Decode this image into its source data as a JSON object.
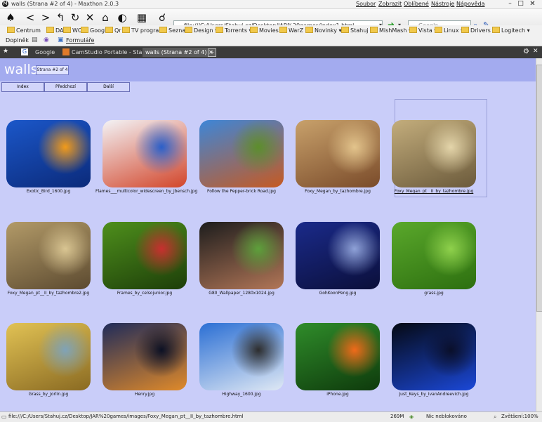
{
  "window": {
    "title": "walls (Strana #2 of 4) - Maxthon 2.0.3",
    "menu": [
      "Soubor",
      "Zobrazit",
      "Oblíbené",
      "Nástroje",
      "Nápověda"
    ]
  },
  "toolbar": {
    "address": "file:///C:/Users/Stahuj.cz/Desktop/JAR%20games/index1.html",
    "search_placeholder": "Google"
  },
  "bookmarks": [
    {
      "label": "Centrum"
    },
    {
      "label": "DA"
    },
    {
      "label": "WC"
    },
    {
      "label": "Google"
    },
    {
      "label": "Qr"
    },
    {
      "label": "TV program"
    },
    {
      "label": "Seznam"
    },
    {
      "label": "Design"
    },
    {
      "label": "Torrents"
    },
    {
      "label": "Movies"
    },
    {
      "label": "WarZ"
    },
    {
      "label": "Novinky"
    },
    {
      "label": "Stahuj"
    },
    {
      "label": "MishMash"
    },
    {
      "label": "Vista"
    },
    {
      "label": "Linux"
    },
    {
      "label": "Drivers"
    },
    {
      "label": "Logitech"
    }
  ],
  "row3": {
    "plugins": "Doplněk",
    "forms": "Formuláře"
  },
  "tabs": [
    {
      "label": "Google"
    },
    {
      "label": "CamStudio Portable - Stahuj.cz"
    },
    {
      "label": "walls (Strana #2 of 4)"
    }
  ],
  "page": {
    "title": "walls",
    "badge": "Strana #2 of 4",
    "nav": [
      "Index",
      "Předchozí",
      "Další"
    ]
  },
  "gallery": [
    {
      "file": "Exotic_Bird_1600.jpg",
      "c1": "#1b57c9",
      "c2": "#0b2a7a",
      "c3": "#f29b1a"
    },
    {
      "file": "Flames___multicolor_widescreen_by_jbensch.jpg",
      "c1": "#f3f3f6",
      "c2": "#d2452a",
      "c3": "#2a5fc9"
    },
    {
      "file": "Follow the Pepper-brick Road.jpg",
      "c1": "#3d86d8",
      "c2": "#c65a22",
      "c3": "#5c8e2c"
    },
    {
      "file": "Foxy_Megan_by_tazhombre.jpg",
      "c1": "#c8a16b",
      "c2": "#7a4b2a",
      "c3": "#e3c48c"
    },
    {
      "file": "Foxy_Megan_pt__II_by_tazhombre.jpg",
      "c1": "#c3ad7c",
      "c2": "#6b5a3b",
      "c3": "#e4d5aa",
      "selected": true
    },
    {
      "file": "Foxy_Megan_pt__II_by_tazhombre2.jpg",
      "c1": "#b29a68",
      "c2": "#5c4a30",
      "c3": "#d9c592"
    },
    {
      "file": "Frames_by_celsojunior.jpg",
      "c1": "#4e8f1c",
      "c2": "#1d3e09",
      "c3": "#c82f2f"
    },
    {
      "file": "G80_Wallpaper_1280x1024.jpg",
      "c1": "#1d1d1d",
      "c2": "#b27657",
      "c3": "#5da03b"
    },
    {
      "file": "GohKoonPeng.jpg",
      "c1": "#1a2a8a",
      "c2": "#0b0f3a",
      "c3": "#8fa2d8"
    },
    {
      "file": "grass.jpg",
      "c1": "#5aa82b",
      "c2": "#2d6f10",
      "c3": "#8fd14c"
    },
    {
      "file": "Grass_by_Jorlin.jpg",
      "c1": "#e1c254",
      "c2": "#8a6a22",
      "c3": "#7fa3b8"
    },
    {
      "file": "Henry.jpg",
      "c1": "#1f2b5a",
      "c2": "#e08a2a",
      "c3": "#0b1024"
    },
    {
      "file": "Highway_1600.jpg",
      "c1": "#2b6fd4",
      "c2": "#dfe8f4",
      "c3": "#2d2d2d"
    },
    {
      "file": "iPhone.jpg",
      "c1": "#2f8c2a",
      "c2": "#0e3a0c",
      "c3": "#f06a1a"
    },
    {
      "file": "Just_Keys_by_IvanAndreevich.jpg",
      "c1": "#050913",
      "c2": "#1b48d8",
      "c3": "#0a0f2a"
    }
  ],
  "status": {
    "path": "file:///C:/Users/Stahuj.cz/Desktop/JAR%20games/images/Foxy_Megan_pt__II_by_tazhombre.html",
    "memory": "269M",
    "block": "Nic neblokováno",
    "zoom": "Zvětšení:100%"
  }
}
